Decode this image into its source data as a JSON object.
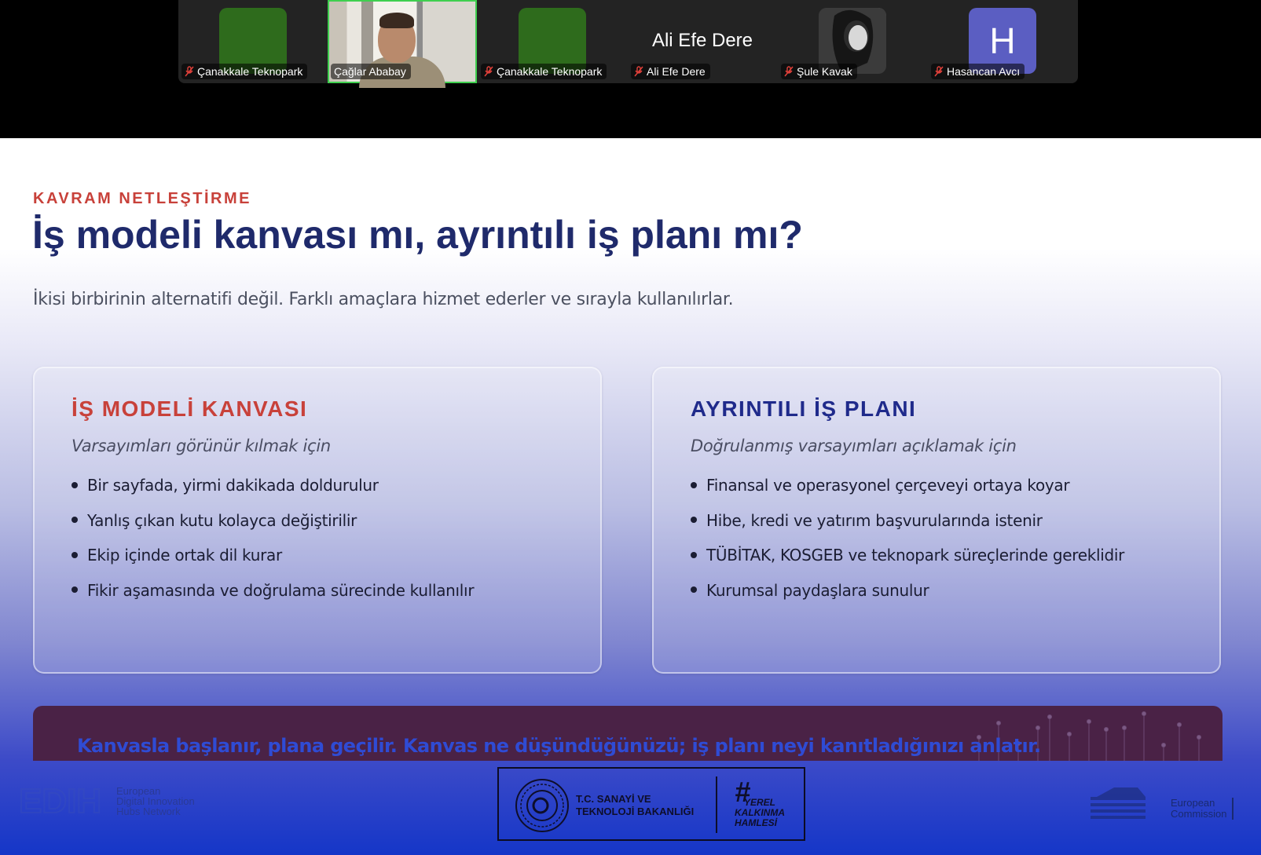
{
  "participants": [
    {
      "name": "Çanakkale Teknopark",
      "avatar": "green-tile",
      "muted": true
    },
    {
      "name": "Çağlar Ababay",
      "avatar": "camera-video",
      "muted": false,
      "active": true
    },
    {
      "name": "Çanakkale Teknopark",
      "avatar": "green-tile",
      "muted": true
    },
    {
      "name": "Ali Efe Dere",
      "avatar": "name-only",
      "muted": true,
      "display_name": "Ali Efe Dere"
    },
    {
      "name": "Şule Kavak",
      "avatar": "photo",
      "muted": true
    },
    {
      "name": "Hasancan Avcı",
      "avatar": "letter",
      "letter": "H",
      "muted": true
    }
  ],
  "slide": {
    "eyebrow": "KAVRAM NETLEŞTİRME",
    "title": "İş modeli kanvası mı, ayrıntılı iş planı mı?",
    "subtitle": "İkisi birbirinin alternatifi değil. Farklı amaçlara hizmet ederler ve sırayla kullanılırlar.",
    "cards": [
      {
        "title": "İŞ MODELİ KANVASI",
        "subtitle": "Varsayımları görünür kılmak için",
        "bullets": [
          "Bir sayfada, yirmi dakikada doldurulur",
          "Yanlış çıkan kutu kolayca değiştirilir",
          "Ekip içinde ortak dil kurar",
          "Fikir aşamasında ve doğrulama sürecinde kullanılır"
        ]
      },
      {
        "title": "AYRINTILI İŞ PLANI",
        "subtitle": "Doğrulanmış varsayımları açıklamak için",
        "bullets": [
          "Finansal ve operasyonel çerçeveyi ortaya koyar",
          "Hibe, kredi ve yatırım başvurularında istenir",
          "TÜBİTAK, KOSGEB ve teknopark süreçlerinde gereklidir",
          "Kurumsal paydaşlara sunulur"
        ]
      }
    ],
    "callout": "Kanvasla başlanır, plana geçilir. Kanvas ne düşündüğünüzü; iş planı neyi kanıtladığınızı anlatır."
  },
  "footer": {
    "edih_logo": "EDIH",
    "edih_text": [
      "European",
      "Digital Innovation",
      "Hubs Network"
    ],
    "ministry": [
      "T.C. SANAYİ VE",
      "TEKNOLOJİ BAKANLIĞI"
    ],
    "hashtag": "#",
    "hashtag_words": [
      "YEREL",
      "KALKINMA",
      "HAMLESİ"
    ],
    "ec": [
      "European",
      "Commission"
    ]
  },
  "colors": {
    "accent_red": "#c8413a",
    "title_navy": "#1f2a6b",
    "active_speaker": "#3fcf4f",
    "callout_bg": "#4a2246"
  }
}
